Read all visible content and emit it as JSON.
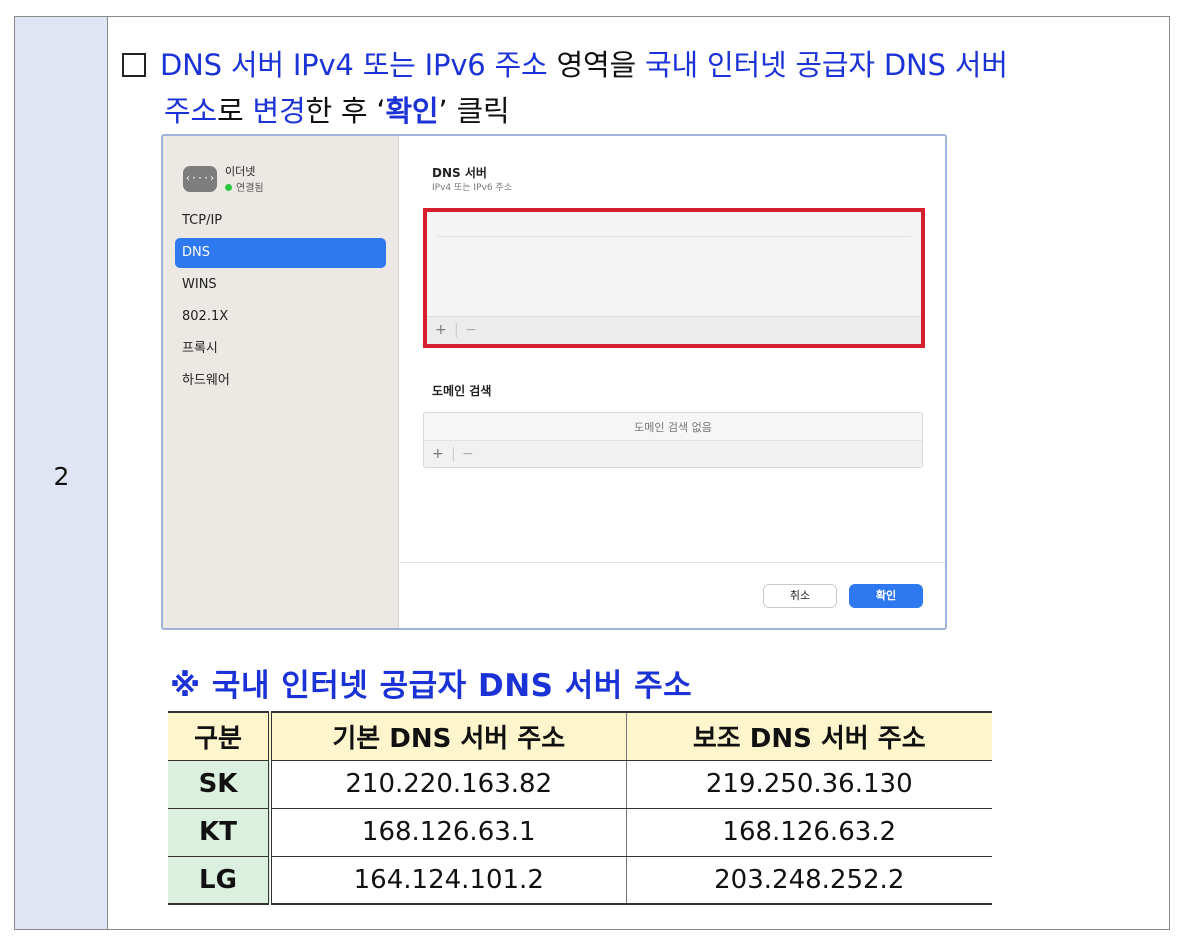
{
  "step_number": "2",
  "instruction": {
    "checkbox_glyph": "☐",
    "segment_1": "DNS 서버 IPv4 또는 IPv6 주소",
    "segment_2": " 영역을 ",
    "segment_3": "국내 인터넷 공급자 DNS 서버",
    "segment_4": "주소",
    "segment_5": "로 ",
    "segment_6": "변경",
    "segment_7": "한 후 ‘",
    "segment_8": "확인",
    "segment_9": "’ 클릭"
  },
  "window": {
    "sidebar": {
      "icon_glyph": "‹···›",
      "connection_name": "이더넷",
      "connection_status": "연결됨",
      "items": [
        "TCP/IP",
        "DNS",
        "WINS",
        "802.1X",
        "프록시",
        "하드웨어"
      ],
      "active_index": 1
    },
    "dns_section": {
      "title": "DNS 서버",
      "subtitle": "IPv4 또는 IPv6 주소",
      "add_glyph": "+",
      "separator_glyph": "|",
      "remove_glyph": "−"
    },
    "domain_section": {
      "title": "도메인 검색",
      "empty_text": "도메인 검색 없음",
      "add_glyph": "+",
      "separator_glyph": "|",
      "remove_glyph": "−"
    },
    "buttons": {
      "cancel": "취소",
      "ok": "확인"
    }
  },
  "note_title": "※ 국내 인터넷 공급자 DNS 서버 주소",
  "dns_table": {
    "headers": [
      "구분",
      "기본 DNS 서버 주소",
      "보조 DNS 서버 주소"
    ],
    "rows": [
      [
        "SK",
        "210.220.163.82",
        "219.250.36.130"
      ],
      [
        "KT",
        "168.126.63.1",
        "168.126.63.2"
      ],
      [
        "LG",
        "164.124.101.2",
        "203.248.252.2"
      ]
    ]
  },
  "colors": {
    "accent_blue_text": "#1b33d6",
    "highlight_red": "#d4202c",
    "mac_selection_blue": "#2e78f0",
    "step_cell_bg": "#dfe5f3",
    "table_header_bg": "#fdf5cc",
    "table_isp_bg": "#dcf0df"
  }
}
